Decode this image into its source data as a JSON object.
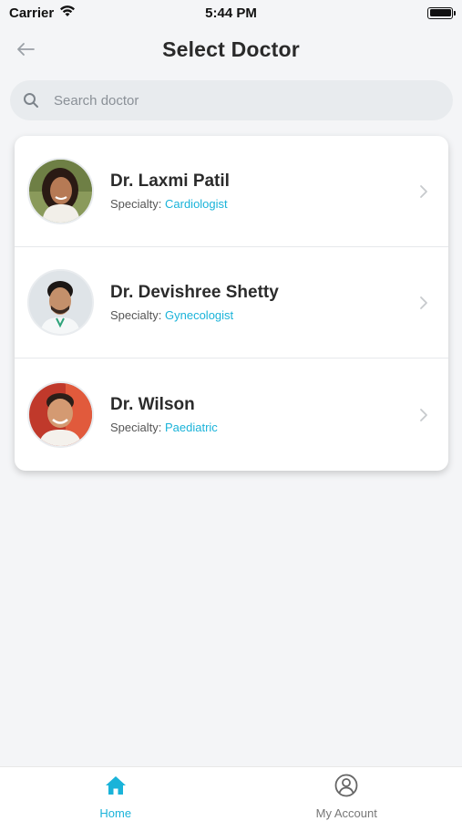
{
  "status_bar": {
    "carrier": "Carrier",
    "time": "5:44 PM"
  },
  "header": {
    "title": "Select Doctor",
    "back_icon": "arrow-left-icon"
  },
  "search": {
    "placeholder": "Search doctor",
    "value": "",
    "icon": "search-icon"
  },
  "colors": {
    "accent": "#1ab3d9",
    "background": "#f4f5f7",
    "card": "#ffffff"
  },
  "doctors": [
    {
      "name": "Dr. Laxmi Patil",
      "specialty_label": "Specialty:",
      "specialty": "Cardiologist"
    },
    {
      "name": "Dr. Devishree Shetty",
      "specialty_label": "Specialty:",
      "specialty": "Gynecologist"
    },
    {
      "name": "Dr. Wilson",
      "specialty_label": "Specialty:",
      "specialty": "Paediatric"
    }
  ],
  "tab_bar": {
    "tabs": [
      {
        "label": "Home",
        "icon": "home-icon",
        "active": true
      },
      {
        "label": "My Account",
        "icon": "user-circle-icon",
        "active": false
      }
    ]
  }
}
